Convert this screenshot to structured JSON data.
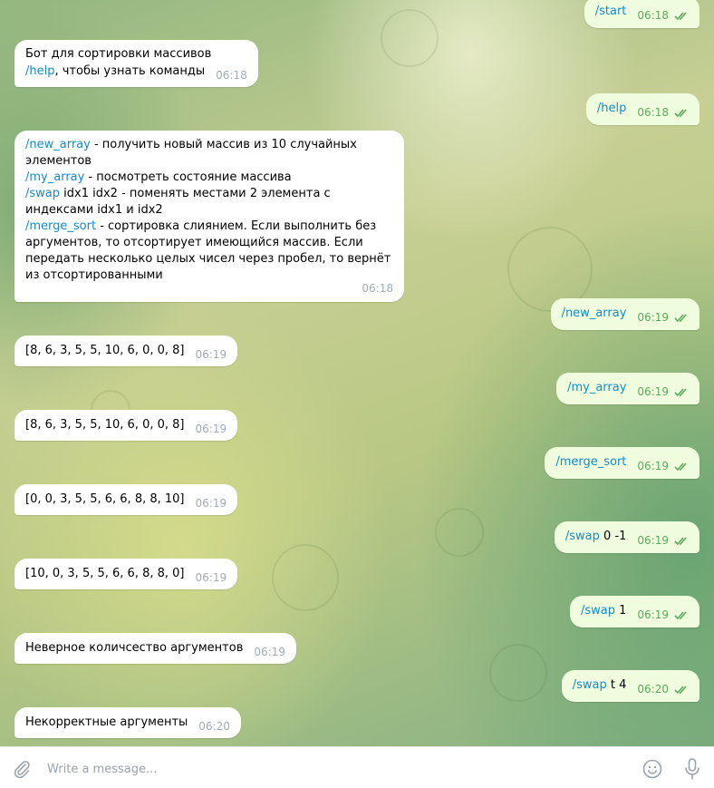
{
  "messages": {
    "m_start": {
      "text": "/start",
      "time": "06:18"
    },
    "m_bot_intro": {
      "line1": "Бот для сортировки массивов",
      "cmd": "/help",
      "tail": ", чтобы узнать команды",
      "time": "06:18"
    },
    "m_help": {
      "text": "/help",
      "time": "06:18"
    },
    "m_help_reply": {
      "c1": "/new_array",
      "t1": " - получить новый массив из 10 случайных элементов",
      "c2": "/my_array",
      "t2": " - посмотреть состояние массива",
      "c3": "/swap",
      "t3": " idx1 idx2 - поменять местами 2 элемента с индексами idx1 и idx2",
      "c4": "/merge_sort",
      "t4": " - сортировка слиянием. Если выполнить без аргументов, то отсортирует имеющийся массив. Если передать несколько целых чисел через пробел, то вернёт из отсортированными",
      "time": "06:18"
    },
    "m_new_array": {
      "text": "/new_array",
      "time": "06:19"
    },
    "m_arr1": {
      "text": "[8, 6, 3, 5, 5, 10, 6, 0, 0, 8]",
      "time": "06:19"
    },
    "m_my_array": {
      "text": "/my_array",
      "time": "06:19"
    },
    "m_arr2": {
      "text": "[8, 6, 3, 5, 5, 10, 6, 0, 0, 8]",
      "time": "06:19"
    },
    "m_merge_sort": {
      "text": "/merge_sort",
      "time": "06:19"
    },
    "m_arr3": {
      "text": "[0, 0, 3, 5, 5, 6, 6, 8, 8, 10]",
      "time": "06:19"
    },
    "m_swap1": {
      "cmd": "/swap",
      "args": " 0 -1",
      "time": "06:19"
    },
    "m_arr4": {
      "text": "[10, 0, 3, 5, 5, 6, 6, 8, 8, 0]",
      "time": "06:19"
    },
    "m_swap2": {
      "cmd": "/swap",
      "args": " 1",
      "time": "06:19"
    },
    "m_err1": {
      "text": "Неверное количсество аргументов",
      "time": "06:19"
    },
    "m_swap3": {
      "cmd": "/swap",
      "args": " t 4",
      "time": "06:20"
    },
    "m_err2": {
      "text": "Некорректные аргументы",
      "time": "06:20"
    }
  },
  "composer": {
    "placeholder": "Write a message..."
  },
  "icons": {
    "attach": "paperclip-icon",
    "emoji": "smiley-icon",
    "mic": "microphone-icon",
    "read": "double-check-icon"
  },
  "colors": {
    "link": "#168acd",
    "outgoing_bubble": "#effdde",
    "incoming_bubble": "#ffffff",
    "read_ticks": "#5ea85e"
  }
}
